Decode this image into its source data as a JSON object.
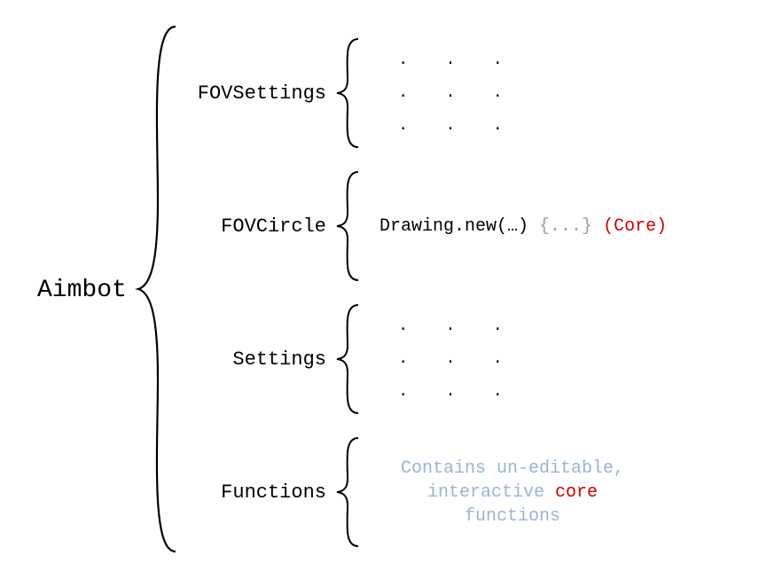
{
  "root": "Aimbot",
  "entries": [
    {
      "label": "FOVSettings",
      "kind": "dots"
    },
    {
      "label": "FOVCircle",
      "kind": "fovcircle",
      "call": "Drawing.new(…)",
      "grey": "{...}",
      "red": "(Core)"
    },
    {
      "label": "Settings",
      "kind": "dots"
    },
    {
      "label": "Functions",
      "kind": "functions",
      "line1_a": "Contains un-editable,",
      "line2_a": "interactive ",
      "line2_core": "core",
      "line2_b": " functions"
    }
  ],
  "dot": "."
}
